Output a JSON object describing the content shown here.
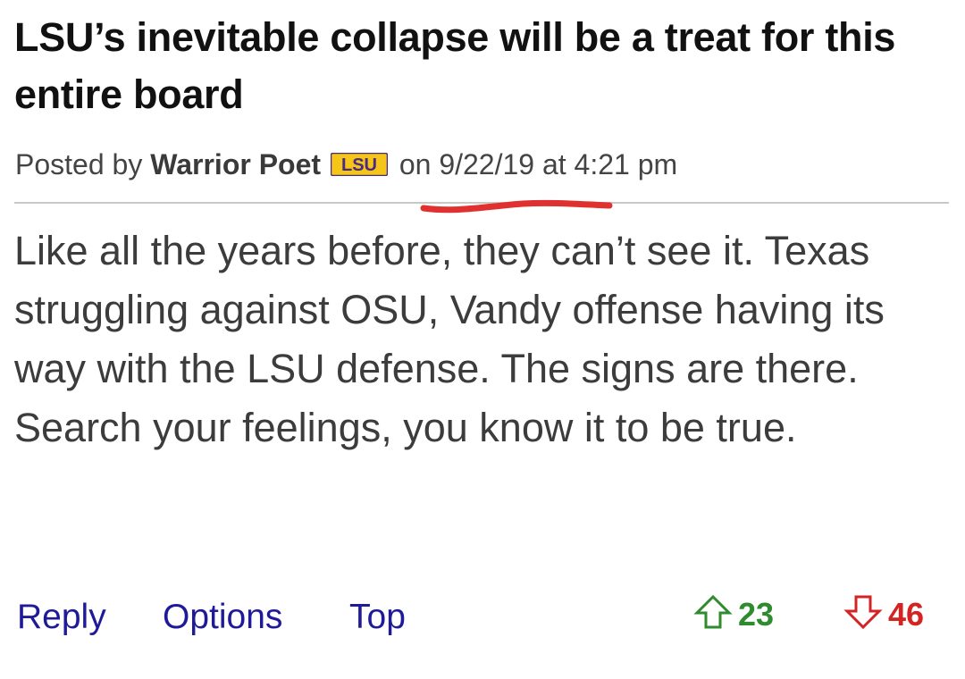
{
  "post": {
    "title": "LSU’s inevitable collapse will be a treat for this entire board",
    "byline": {
      "prefix": "Posted by ",
      "author": "Warrior Poet",
      "team_badge": "LSU",
      "on_word": "on",
      "date": "9/22/19",
      "at_word": "at",
      "time": "4:21 pm"
    },
    "body": "Like all the years before, they can’t see it. Texas struggling against OSU, Vandy offense having its way with the LSU defense. The signs are there. Search your feelings, you know it to be true."
  },
  "actions": {
    "reply": "Reply",
    "options": "Options",
    "top": "Top"
  },
  "votes": {
    "up_icon": "arrow-up-outline-icon",
    "up_count": "23",
    "down_icon": "arrow-down-outline-icon",
    "down_count": "46"
  },
  "colors": {
    "link": "#1f1a99",
    "upvote": "#2e8b2e",
    "downvote": "#d42323",
    "annotation": "#e03030",
    "badge_purple": "#4b2a85",
    "badge_gold": "#f5c518"
  }
}
